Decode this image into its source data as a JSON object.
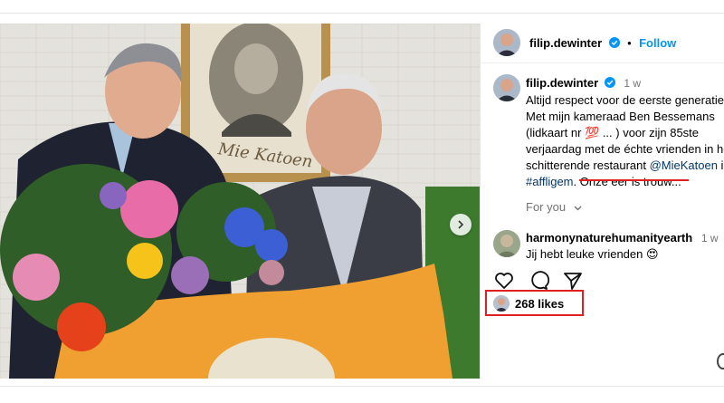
{
  "post": {
    "author": "filip.dewinter",
    "follow_label": "Follow",
    "time_ago": "1 w",
    "caption_lines": [
      "Altijd respect voor de eerste generatie.",
      "Met mijn kameraad Ben Bessemans",
      "(lidkaart nr 💯 ... ) voor zijn 85ste",
      "verjaardag met de échte vrienden in he",
      "schitterende restaurant "
    ],
    "mention": "@MieKatoen",
    "mention_suffix": " in",
    "hashtag": "#affligem",
    "caption_tail": ". Onze eer is trouw...",
    "for_you_label": "For you",
    "likes_label": "268 likes"
  },
  "comment": {
    "author": "harmonynaturehumanityearth",
    "time_ago": "1 w",
    "text": "Jij hebt leuke vrienden 😍"
  },
  "photo": {
    "frame_text": "Mie Katoen"
  },
  "colors": {
    "follow": "#0095f6",
    "link": "#00376b",
    "annotation_red": "#e02020",
    "flag_orange": "#f0a030"
  },
  "icons": [
    "verified-badge-icon",
    "heart-icon",
    "comment-icon",
    "share-icon",
    "chevron-right-icon",
    "chevron-down-icon"
  ]
}
